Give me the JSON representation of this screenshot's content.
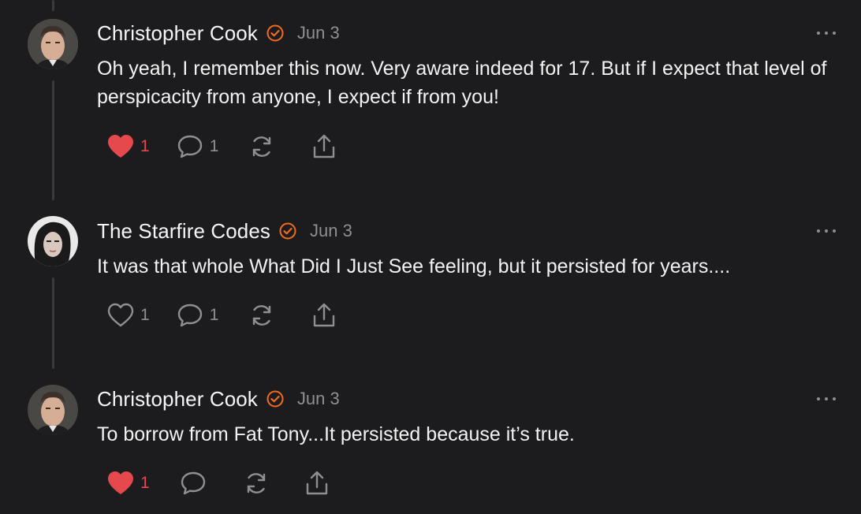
{
  "comments": [
    {
      "author": "Christopher Cook",
      "date": "Jun 3",
      "text": "Oh yeah, I remember this now. Very aware indeed for 17. But if I expect that level of perspicacity from anyone, I expect if from you!",
      "liked": true,
      "likes": "1",
      "replies": "1",
      "icons": {
        "like": "heart-filled-icon",
        "reply": "comment-bubble-icon",
        "restack": "restack-icon",
        "share": "share-icon",
        "verified": "verified-badge-icon",
        "more": "more-icon"
      }
    },
    {
      "author": "The Starfire Codes",
      "date": "Jun 3",
      "text": "It was that whole What Did I Just See feeling, but it persisted for years....",
      "liked": false,
      "likes": "1",
      "replies": "1",
      "icons": {
        "like": "heart-outline-icon",
        "reply": "comment-bubble-icon",
        "restack": "restack-icon",
        "share": "share-icon",
        "verified": "verified-badge-icon",
        "more": "more-icon"
      }
    },
    {
      "author": "Christopher Cook",
      "date": "Jun 3",
      "text": "To borrow from Fat Tony...It persisted because it’s true.",
      "liked": true,
      "likes": "1",
      "replies": "",
      "icons": {
        "like": "heart-filled-icon",
        "reply": "comment-bubble-icon",
        "restack": "restack-icon",
        "share": "share-icon",
        "verified": "verified-badge-icon",
        "more": "more-icon"
      }
    }
  ],
  "colors": {
    "background": "#1c1c1e",
    "accent": "#f26b1d",
    "like": "#e5484d",
    "muted": "#8e8e93",
    "thread_line": "#3a3a3c"
  }
}
